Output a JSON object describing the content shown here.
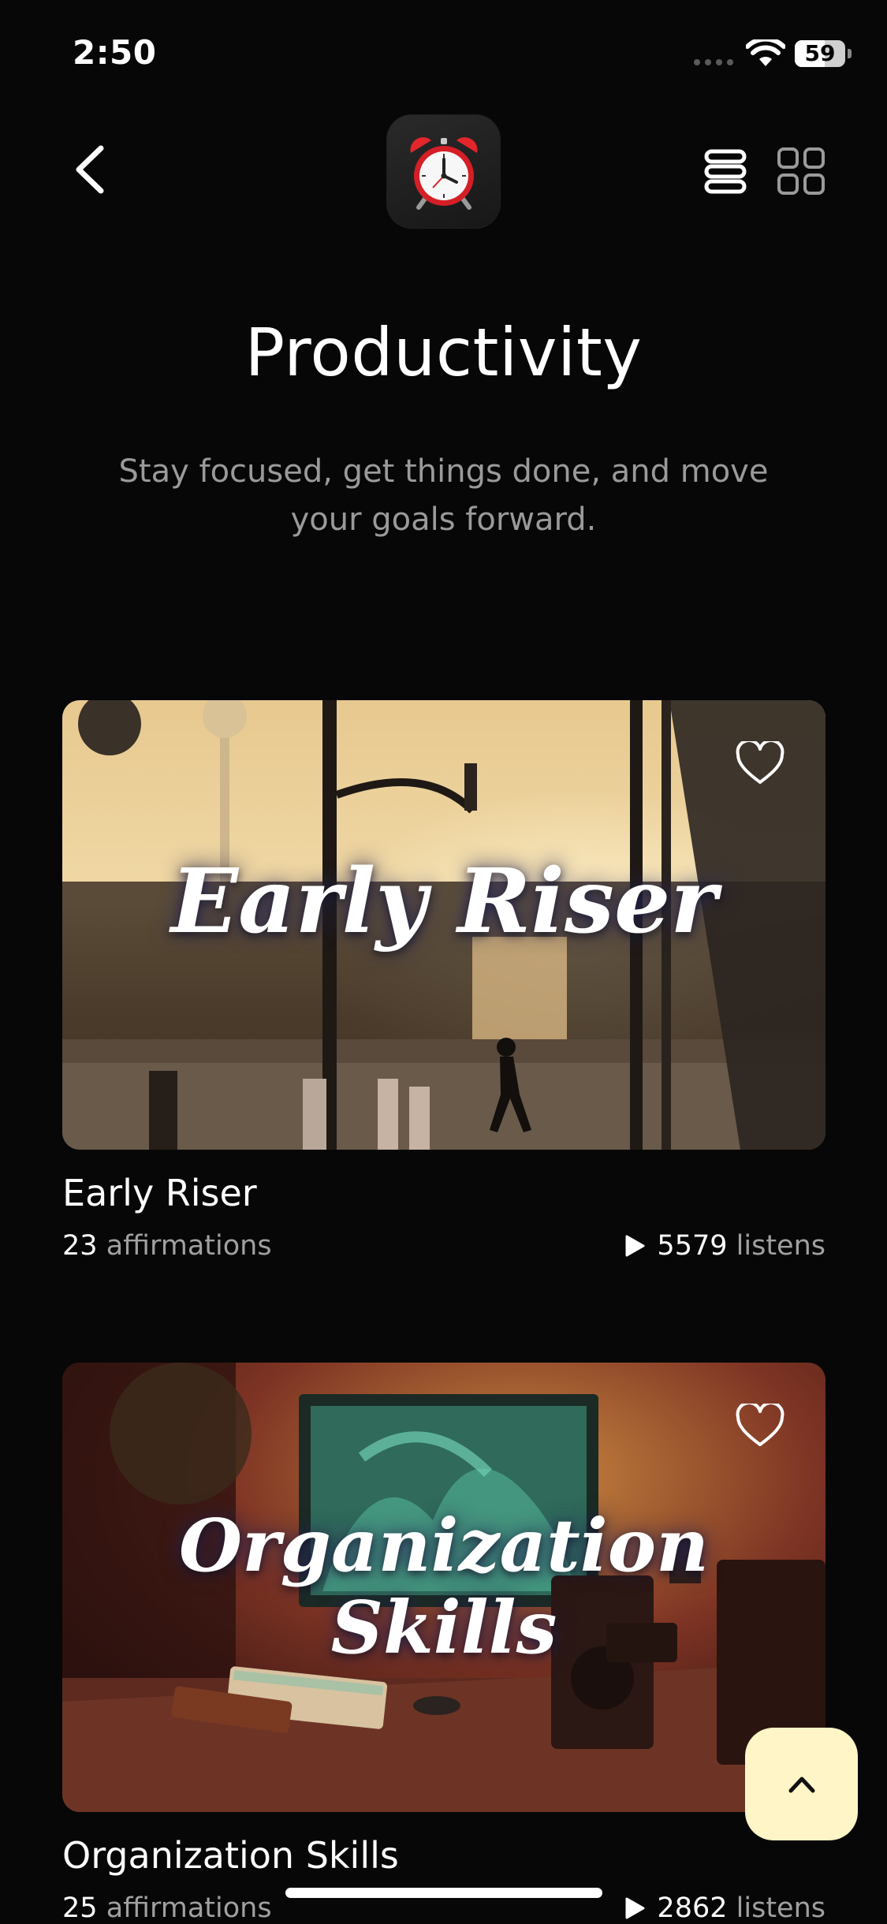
{
  "status_bar": {
    "time": "2:50",
    "battery": "59",
    "battery_level": 0.59
  },
  "header": {
    "app_icon": "alarm-clock-icon",
    "title": "Productivity",
    "subtitle": "Stay focused, get things done, and move your goals forward."
  },
  "icons": {
    "back": "chevron-left-icon",
    "list_view": "list-view-icon",
    "grid_view": "grid-view-icon",
    "favorite": "heart-icon",
    "play": "play-icon",
    "scroll_top": "chevron-up-icon"
  },
  "cards": [
    {
      "overlay_title": "Early Riser",
      "title": "Early Riser",
      "affirmations_count": "23",
      "affirmations_label": "affirmations",
      "listens_count": "5579",
      "listens_label": "listens"
    },
    {
      "overlay_title_line1": "Organization",
      "overlay_title_line2": "Skills",
      "title": "Organization Skills",
      "affirmations_count": "25",
      "affirmations_label": "affirmations",
      "listens_count": "2862",
      "listens_label": "listens"
    }
  ],
  "colors": {
    "background": "#070707",
    "subtitle": "#9a9a9a",
    "scroll_button": "#fff5c7"
  }
}
